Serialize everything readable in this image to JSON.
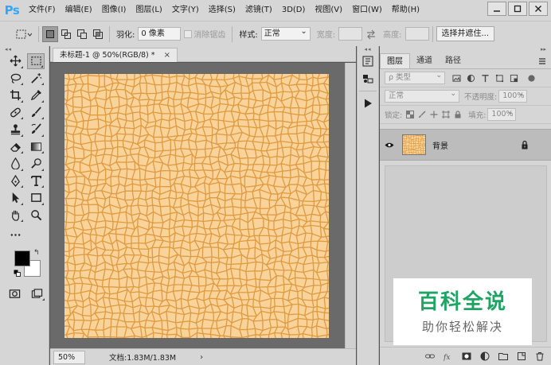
{
  "app": {
    "logo": "Ps"
  },
  "menu": {
    "items": [
      "文件(F)",
      "编辑(E)",
      "图像(I)",
      "图层(L)",
      "文字(Y)",
      "选择(S)",
      "滤镜(T)",
      "3D(D)",
      "视图(V)",
      "窗口(W)",
      "帮助(H)"
    ]
  },
  "options": {
    "feather_label": "羽化:",
    "feather_value": "0 像素",
    "antialias_label": "消除锯齿",
    "style_label": "样式:",
    "style_value": "正常",
    "width_label": "宽度:",
    "height_label": "高度:",
    "select_mask_label": "选择并遮住..."
  },
  "document": {
    "tab_title": "未标题-1 @ 50%(RGB/8) *",
    "tab_close": "×",
    "zoom": "50%",
    "doc_info": "文档:1.83M/1.83M",
    "status_arrow": "›"
  },
  "layers_panel": {
    "tabs": [
      "图层",
      "通道",
      "路径"
    ],
    "filter_kind": "ρ 类型",
    "blend_mode": "正常",
    "opacity_label": "不透明度:",
    "opacity_value": "100%",
    "lock_label": "锁定:",
    "fill_label": "填充:",
    "fill_value": "100%",
    "layer_name": "背景"
  },
  "watermark": {
    "title": "百科全说",
    "subtitle": "助你轻松解决"
  },
  "colors": {
    "foreground": "#000000",
    "background": "#ffffff",
    "canvas_base": "#f7cc8a",
    "canvas_edge": "#e09a40",
    "watermark_green": "#1fa463"
  }
}
